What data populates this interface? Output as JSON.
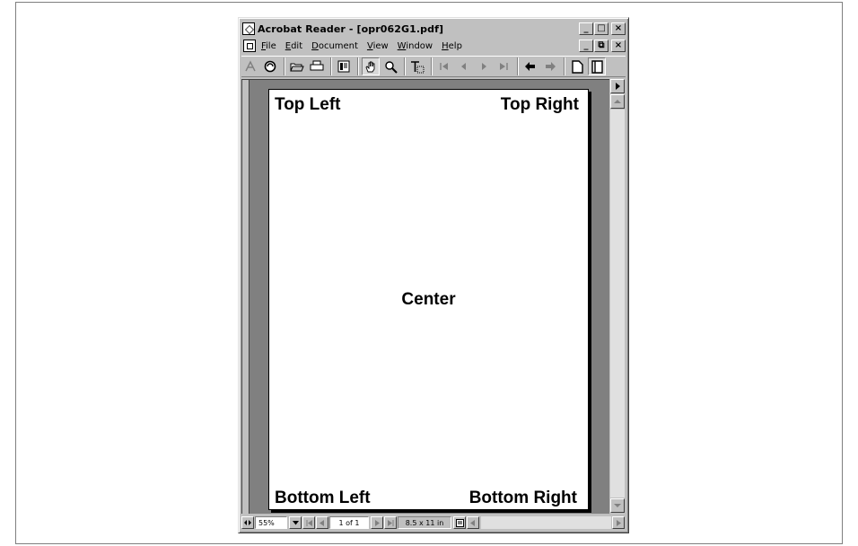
{
  "window": {
    "title": "Acrobat Reader - [opr062G1.pdf]",
    "caption_buttons": [
      "_",
      "□",
      "×"
    ],
    "doc_caption_buttons": [
      "_",
      "⧉",
      "×"
    ]
  },
  "menu": {
    "items": [
      {
        "key": "F",
        "rest": "ile"
      },
      {
        "key": "E",
        "rest": "dit"
      },
      {
        "key": "D",
        "rest": "ocument"
      },
      {
        "key": "V",
        "rest": "iew"
      },
      {
        "key": "W",
        "rest": "indow"
      },
      {
        "key": "H",
        "rest": "elp"
      }
    ]
  },
  "toolbar": {
    "acrobat_icon": "acrobat-logo-icon",
    "web_icon": "web-capture-icon",
    "open_icon": "open-folder-icon",
    "print_icon": "print-icon",
    "show_hide_icon": "navigation-pane-icon",
    "hand_icon": "hand-tool-icon",
    "zoom_icon": "zoom-tool-icon",
    "text_icon": "text-select-icon",
    "first_icon": "first-page-icon",
    "prev_icon": "previous-page-icon",
    "next_icon": "next-page-icon",
    "last_icon": "last-page-icon",
    "back_icon": "go-back-icon",
    "forward_icon": "go-forward-icon",
    "actual_size_icon": "actual-size-icon",
    "fit_page_icon": "fit-page-icon"
  },
  "page": {
    "top_left": "Top Left",
    "top_right": "Top Right",
    "center": "Center",
    "bottom_left": "Bottom Left",
    "bottom_right": "Bottom Right"
  },
  "status": {
    "zoom": "55%",
    "page_indicator": "1 of 1",
    "page_size": "8.5 x 11 in"
  },
  "colors": {
    "chrome": "#c0c0c0",
    "workspace": "#808080",
    "page": "#ffffff"
  }
}
